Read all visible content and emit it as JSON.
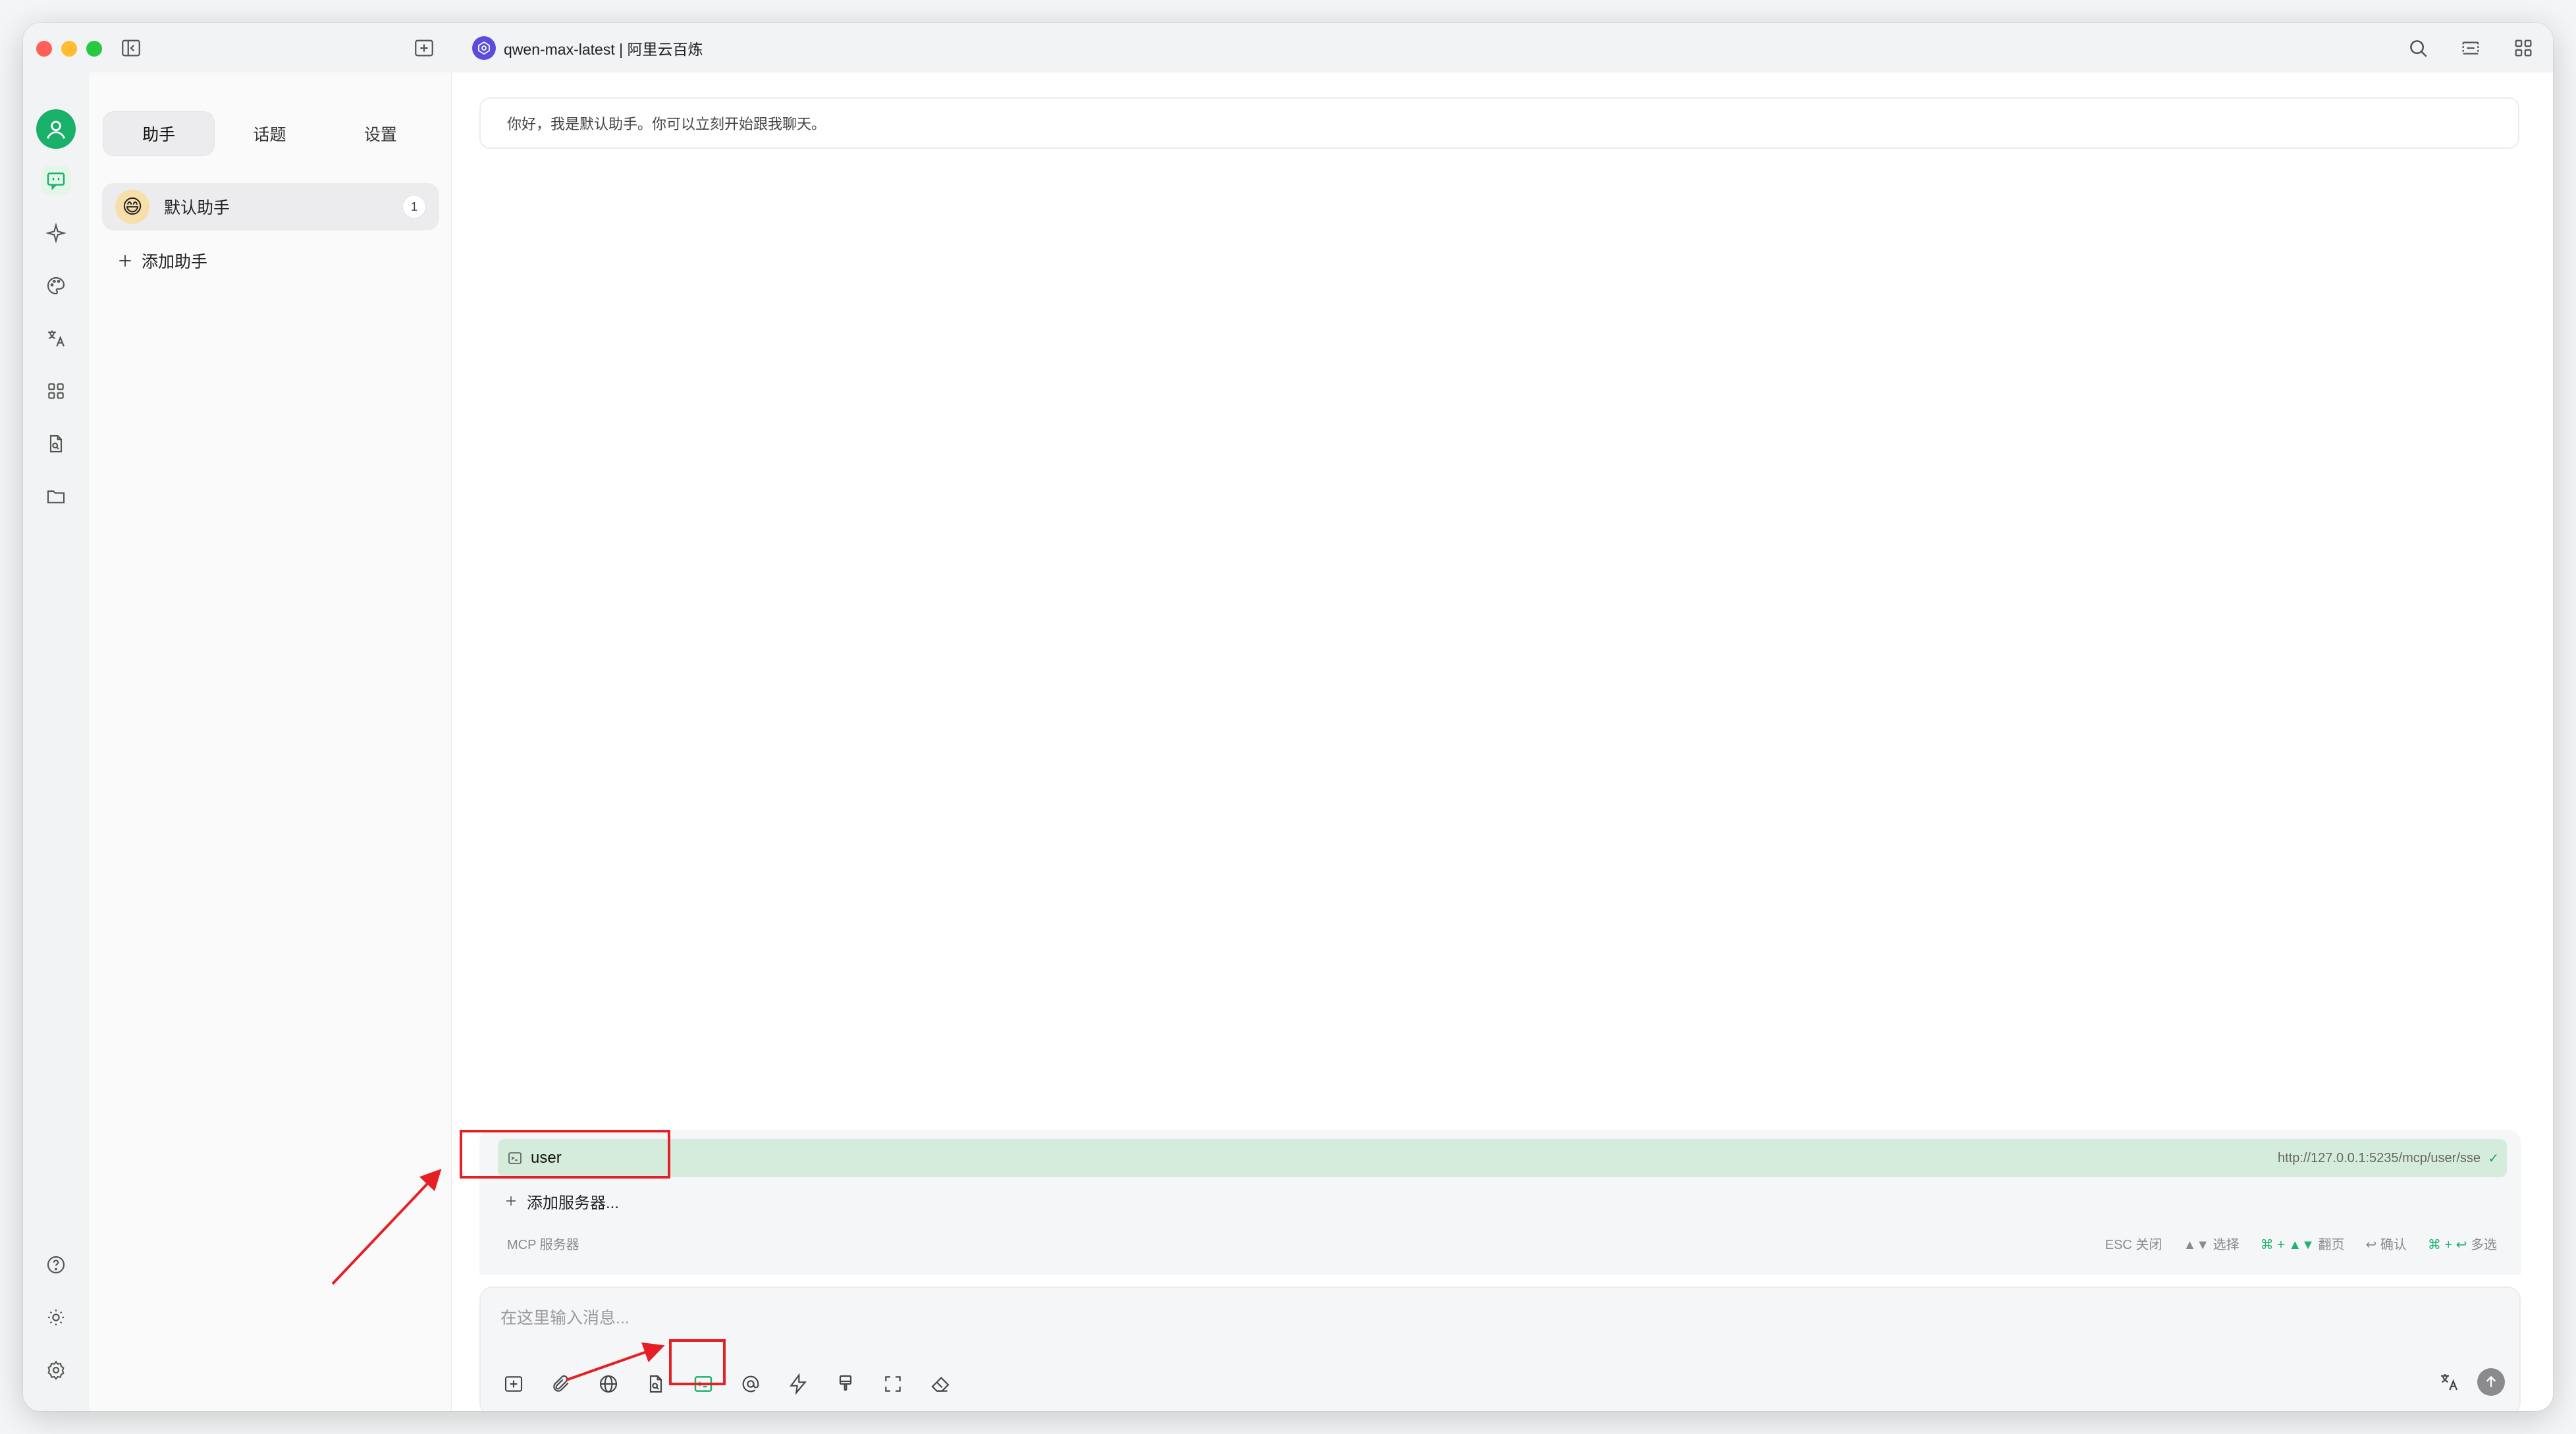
{
  "window": {
    "model_title": "qwen-max-latest | 阿里云百炼"
  },
  "panel": {
    "tabs": [
      {
        "label": "助手",
        "active": true
      },
      {
        "label": "话题",
        "active": false
      },
      {
        "label": "设置",
        "active": false
      }
    ],
    "assistant": {
      "name": "默认助手",
      "count": "1",
      "emoji": "😄"
    },
    "add_assistant_label": "添加助手"
  },
  "main": {
    "greeting": "你好，我是默认助手。你可以立刻开始跟我聊天。"
  },
  "mcp": {
    "server": {
      "name": "user",
      "url": "http://127.0.0.1:5235/mcp/user/sse",
      "check": "✓"
    },
    "add_server_label": "添加服务器...",
    "section_label": "MCP 服务器",
    "hints": {
      "close": "ESC 关闭",
      "select": "▲▼ 选择",
      "page_key": "⌘ + ▲▼",
      "page_text": "翻页",
      "confirm": "↩ 确认",
      "multi_key": "⌘ + ↩",
      "multi_text": "多选"
    }
  },
  "input": {
    "placeholder": "在这里输入消息..."
  },
  "colors": {
    "accent": "#19b06a",
    "highlight_row": "#d5ecdc",
    "annotation_red": "#e61f24"
  }
}
